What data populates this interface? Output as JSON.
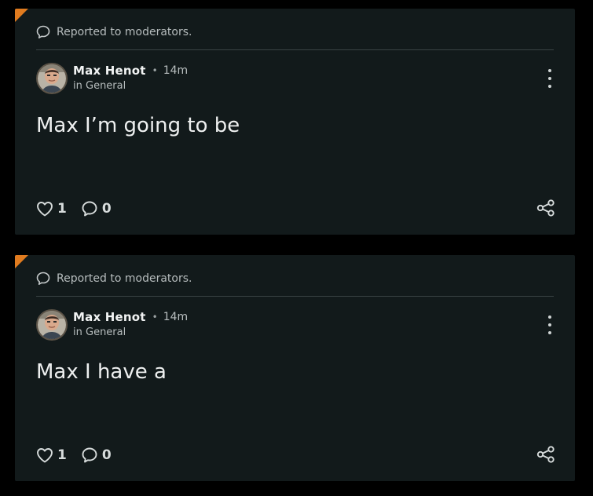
{
  "posts": [
    {
      "reported_text": "Reported to moderators.",
      "author": "Max Henot",
      "separator": "•",
      "time": "14m",
      "community_prefix": "in",
      "community": "General",
      "body": "Max I’m going to be",
      "likes": "1",
      "comments": "0",
      "icons": {
        "reported": "speech-bubble-icon",
        "menu": "kebab-menu-icon",
        "like": "heart-icon",
        "comment": "comment-icon",
        "share": "share-icon"
      }
    },
    {
      "reported_text": "Reported to moderators.",
      "author": "Max Henot",
      "separator": "•",
      "time": "14m",
      "community_prefix": "in",
      "community": "General",
      "body": "Max I have a",
      "likes": "1",
      "comments": "0",
      "icons": {
        "reported": "speech-bubble-icon",
        "menu": "kebab-menu-icon",
        "like": "heart-icon",
        "comment": "comment-icon",
        "share": "share-icon"
      }
    }
  ],
  "colors": {
    "background": "#000000",
    "card": "#121a1b",
    "flag": "#e07b1f",
    "text": "#eef0f0",
    "muted": "#b7bdbe"
  }
}
